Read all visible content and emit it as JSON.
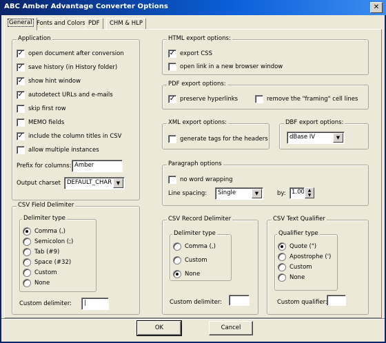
{
  "window": {
    "title": "ABC Amber Advantage Converter Options"
  },
  "tabs": [
    {
      "label": "General"
    },
    {
      "label": "Fonts and Colors"
    },
    {
      "label": "PDF"
    },
    {
      "label": "CHM & HLP"
    }
  ],
  "application": {
    "title": "Application",
    "options": [
      {
        "label": "open document after conversion",
        "checked": true
      },
      {
        "label": "save history (in History folder)",
        "checked": true
      },
      {
        "label": "show hint window",
        "checked": true
      },
      {
        "label": "autodetect URLs and e-mails",
        "checked": true
      },
      {
        "label": "skip first row",
        "checked": false
      },
      {
        "label": "MEMO fields",
        "checked": false
      },
      {
        "label": "include the column titles in CSV",
        "checked": true
      },
      {
        "label": "allow multiple instances",
        "checked": false
      }
    ],
    "prefix_label": "Prefix for columns:",
    "prefix_value": "Amber",
    "charset_label": "Output charset",
    "charset_value": "DEFAULT_CHAR"
  },
  "csv_field": {
    "title": "CSV Field Delimiter",
    "type_title": "Delimiter type",
    "options": [
      {
        "label": "Comma (,)",
        "selected": true
      },
      {
        "label": "Semicolon (;)",
        "selected": false
      },
      {
        "label": "Tab (#9)",
        "selected": false
      },
      {
        "label": "Space (#32)",
        "selected": false
      },
      {
        "label": "Custom",
        "selected": false
      },
      {
        "label": "None",
        "selected": false
      }
    ],
    "custom_label": "Custom delimiter:",
    "custom_value": "|"
  },
  "html_export": {
    "title": "HTML export options:",
    "options": [
      {
        "label": "export CSS",
        "checked": true
      },
      {
        "label": "open link in a new browser window",
        "checked": false
      }
    ]
  },
  "pdf_export": {
    "title": "PDF export options:",
    "options": [
      {
        "label": "preserve hyperlinks",
        "checked": true
      },
      {
        "label": "remove the \"framing\" cell lines",
        "checked": false
      }
    ]
  },
  "xml_export": {
    "title": "XML export options:",
    "options": [
      {
        "label": "generate tags for the headers",
        "checked": false
      }
    ]
  },
  "dbf_export": {
    "title": "DBF export options:",
    "value": "dBase IV"
  },
  "paragraph": {
    "title": "Paragraph options",
    "no_wrap_label": "no word wrapping",
    "no_wrap_checked": false,
    "spacing_label": "Line spacing:",
    "spacing_value": "Single",
    "by_label": "by:",
    "by_value": "1.00"
  },
  "csv_record": {
    "title": "CSV Record Delimiter",
    "type_title": "Delimiter type",
    "options": [
      {
        "label": "Comma (,)",
        "selected": false
      },
      {
        "label": "Custom",
        "selected": false
      },
      {
        "label": "None",
        "selected": true
      }
    ],
    "custom_label": "Custom delimiter:",
    "custom_value": ""
  },
  "csv_text": {
    "title": "CSV Text Qualifier",
    "type_title": "Qualifier type",
    "options": [
      {
        "label": "Quote (\")",
        "selected": true
      },
      {
        "label": "Apostrophe (')",
        "selected": false
      },
      {
        "label": "Custom",
        "selected": false
      },
      {
        "label": "None",
        "selected": false
      }
    ],
    "custom_label": "Custom qualifier:",
    "custom_value": ""
  },
  "buttons": {
    "ok": "OK",
    "cancel": "Cancel"
  },
  "icons": {
    "close": "close-icon",
    "dropdown": "chevron-down-icon",
    "spin": "spin-arrows-icon"
  }
}
